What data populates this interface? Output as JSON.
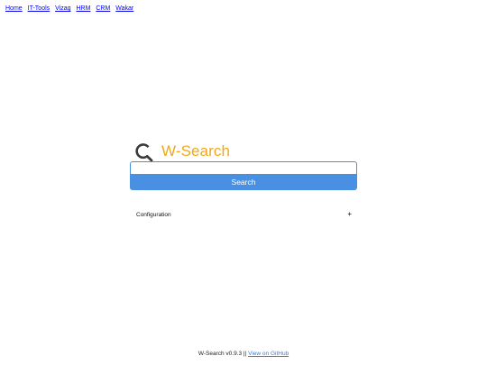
{
  "nav": {
    "links": [
      "Home",
      "IT-Tools",
      "Vizag",
      "HRM",
      "CRM",
      "Wakar"
    ]
  },
  "logo": {
    "icon": "search-icon",
    "text": "W-Search",
    "color": "#f0a81a"
  },
  "search": {
    "value": "",
    "placeholder": "",
    "button_label": "Search",
    "accent_color": "#4a90e2"
  },
  "config": {
    "label": "Configuration",
    "toggle": "+"
  },
  "footer": {
    "version": "W-Search v0.9.3",
    "separator": "||",
    "github_link": "View on GitHub"
  }
}
